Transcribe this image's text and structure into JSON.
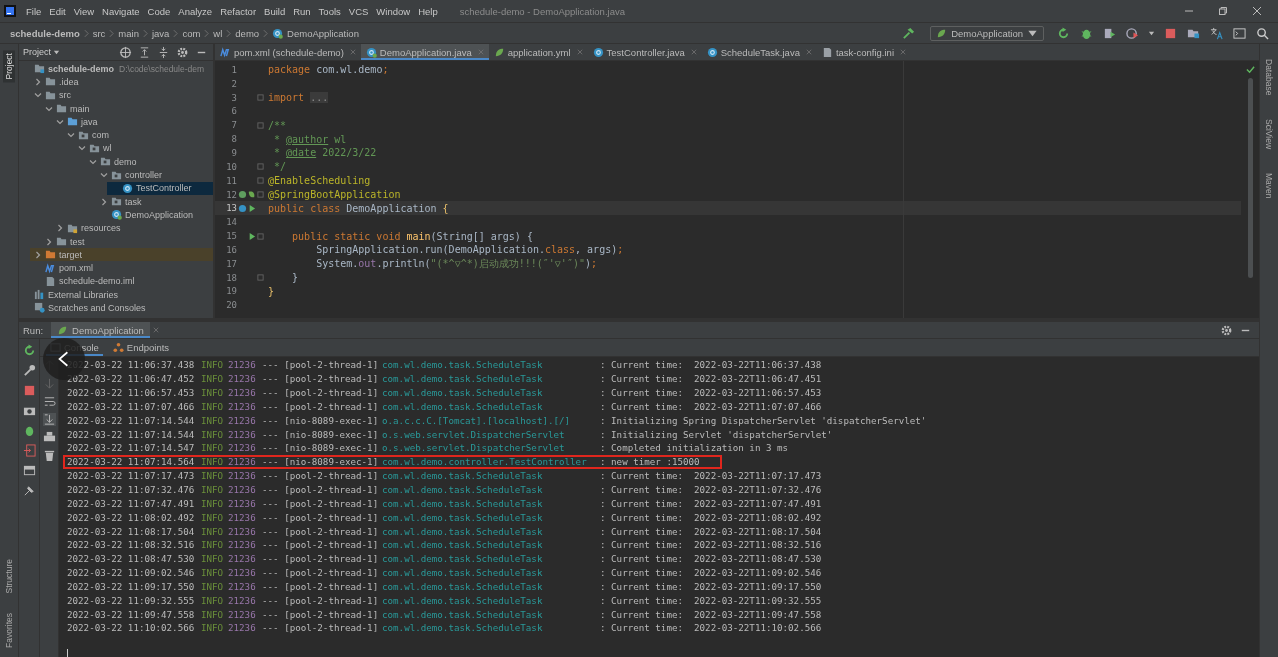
{
  "window": {
    "title": "schedule-demo - DemoApplication.java"
  },
  "menu": [
    "File",
    "Edit",
    "View",
    "Navigate",
    "Code",
    "Analyze",
    "Refactor",
    "Build",
    "Run",
    "Tools",
    "VCS",
    "Window",
    "Help"
  ],
  "breadcrumbs": [
    {
      "label": "schedule-demo",
      "kind": "project"
    },
    {
      "label": "src",
      "kind": "folder"
    },
    {
      "label": "main",
      "kind": "folder"
    },
    {
      "label": "java",
      "kind": "folder"
    },
    {
      "label": "com",
      "kind": "folder"
    },
    {
      "label": "wl",
      "kind": "folder"
    },
    {
      "label": "demo",
      "kind": "folder"
    },
    {
      "label": "DemoApplication",
      "kind": "class"
    }
  ],
  "run_config": "DemoApplication",
  "left_strip": {
    "top": [
      {
        "label": "Project",
        "selected": true
      }
    ],
    "bottom": [
      {
        "label": "Structure",
        "selected": false
      },
      {
        "label": "Favorites",
        "selected": false
      }
    ]
  },
  "right_strip": [
    {
      "label": "Database",
      "selected": false
    },
    {
      "label": "SciView",
      "selected": false
    },
    {
      "label": "Maven",
      "selected": false
    }
  ],
  "project_panel": {
    "title": "Project",
    "tree": [
      {
        "label": "schedule-demo",
        "path": "D:\\code\\schedule-dem",
        "kind": "module",
        "selected": false,
        "excluded": false,
        "children": [
          {
            "label": ".idea",
            "kind": "folder",
            "expanded": false,
            "selected": false,
            "excluded": false
          },
          {
            "label": "src",
            "kind": "folder",
            "expanded": true,
            "selected": false,
            "excluded": false,
            "children": [
              {
                "label": "main",
                "kind": "folder",
                "expanded": true,
                "selected": false,
                "excluded": false,
                "children": [
                  {
                    "label": "java",
                    "kind": "source",
                    "expanded": true,
                    "selected": false,
                    "excluded": false,
                    "children": [
                      {
                        "label": "com",
                        "kind": "package",
                        "expanded": true,
                        "selected": false,
                        "excluded": false,
                        "children": [
                          {
                            "label": "wl",
                            "kind": "package",
                            "expanded": true,
                            "selected": false,
                            "excluded": false,
                            "children": [
                              {
                                "label": "demo",
                                "kind": "package",
                                "expanded": true,
                                "selected": false,
                                "excluded": false,
                                "children": [
                                  {
                                    "label": "controller",
                                    "kind": "package",
                                    "expanded": true,
                                    "selected": false,
                                    "excluded": false,
                                    "children": [
                                      {
                                        "label": "TestController",
                                        "kind": "class",
                                        "selected": true,
                                        "excluded": false
                                      }
                                    ]
                                  },
                                  {
                                    "label": "task",
                                    "kind": "package",
                                    "expanded": false,
                                    "selected": false,
                                    "excluded": false
                                  },
                                  {
                                    "label": "DemoApplication",
                                    "kind": "app",
                                    "selected": false,
                                    "excluded": false
                                  }
                                ]
                              }
                            ]
                          }
                        ]
                      }
                    ]
                  },
                  {
                    "label": "resources",
                    "kind": "resources",
                    "expanded": false,
                    "selected": false,
                    "excluded": false
                  }
                ]
              },
              {
                "label": "test",
                "kind": "folder",
                "expanded": false,
                "selected": false,
                "excluded": false
              }
            ]
          },
          {
            "label": "target",
            "kind": "target",
            "expanded": false,
            "selected": false,
            "excluded": true
          },
          {
            "label": "pom.xml",
            "kind": "maven",
            "selected": false,
            "excluded": false
          },
          {
            "label": "schedule-demo.iml",
            "kind": "iml",
            "selected": false,
            "excluded": false
          }
        ]
      },
      {
        "label": "External Libraries",
        "kind": "libraries",
        "selected": false,
        "excluded": false
      },
      {
        "label": "Scratches and Consoles",
        "kind": "scratches",
        "selected": false,
        "excluded": false
      }
    ]
  },
  "editor_tabs": [
    {
      "label": "pom.xml (schedule-demo)",
      "kind": "maven",
      "selected": false
    },
    {
      "label": "DemoApplication.java",
      "kind": "app",
      "selected": true
    },
    {
      "label": "application.yml",
      "kind": "yml",
      "selected": false
    },
    {
      "label": "TestController.java",
      "kind": "class",
      "selected": false
    },
    {
      "label": "ScheduleTask.java",
      "kind": "class",
      "selected": false
    },
    {
      "label": "task-config.ini",
      "kind": "file",
      "selected": false
    }
  ],
  "code_lines": [
    {
      "number": "1",
      "fold": false,
      "current": false,
      "tokens": [
        {
          "t": "package ",
          "kind": "kw"
        },
        {
          "t": "com.wl.demo",
          "kind": "plain"
        },
        {
          "t": ";",
          "kind": "kw"
        }
      ]
    },
    {
      "number": "2",
      "fold": false,
      "current": false
    },
    {
      "number": "3",
      "fold": true,
      "current": false,
      "tokens": [
        {
          "t": "import ",
          "kind": "kw"
        },
        {
          "t": "...",
          "kind": "folded"
        }
      ]
    },
    {
      "number": "6",
      "fold": false,
      "current": false
    },
    {
      "number": "7",
      "fold": true,
      "current": false,
      "tokens": [
        {
          "t": "/**",
          "kind": "doc"
        }
      ]
    },
    {
      "number": "8",
      "fold": false,
      "current": false,
      "tokens": [
        {
          "t": " * ",
          "kind": "doc"
        },
        {
          "t": "@author",
          "kind": "doctag"
        },
        {
          "t": " wl",
          "kind": "doc"
        }
      ]
    },
    {
      "number": "9",
      "fold": false,
      "current": false,
      "tokens": [
        {
          "t": " * ",
          "kind": "doc"
        },
        {
          "t": "@date",
          "kind": "doctag"
        },
        {
          "t": " 2022/3/22",
          "kind": "doc"
        }
      ]
    },
    {
      "number": "10",
      "fold": true,
      "current": false,
      "tokens": [
        {
          "t": " */",
          "kind": "doc"
        }
      ]
    },
    {
      "number": "11",
      "fold": true,
      "current": false,
      "tokens": [
        {
          "t": "@EnableScheduling",
          "kind": "ann"
        }
      ]
    },
    {
      "number": "12",
      "fold": true,
      "current": false,
      "kind": "bean",
      "tokens": [
        {
          "t": "@SpringBootApplication",
          "kind": "ann"
        }
      ]
    },
    {
      "number": "13",
      "fold": false,
      "current": true,
      "kind": "bean-run",
      "tokens": [
        {
          "t": "public class ",
          "kind": "kw"
        },
        {
          "t": "DemoApplication ",
          "kind": "plain"
        },
        {
          "t": "{",
          "kind": "brace"
        }
      ]
    },
    {
      "number": "14",
      "fold": false,
      "current": false
    },
    {
      "number": "15",
      "fold": true,
      "current": false,
      "kind": "run",
      "tokens": [
        {
          "t": "    public static void ",
          "kind": "kw"
        },
        {
          "t": "main",
          "kind": "fn"
        },
        {
          "t": "(String[] args) {",
          "kind": "plain"
        }
      ]
    },
    {
      "number": "16",
      "fold": false,
      "current": false,
      "tokens": [
        {
          "t": "        SpringApplication.run(DemoApplication.",
          "kind": "plain"
        },
        {
          "t": "class",
          "kind": "kw"
        },
        {
          "t": ", args)",
          "kind": "plain"
        },
        {
          "t": ";",
          "kind": "kw"
        }
      ]
    },
    {
      "number": "17",
      "fold": false,
      "current": false,
      "tokens": [
        {
          "t": "        System.",
          "kind": "plain"
        },
        {
          "t": "out",
          "kind": "field"
        },
        {
          "t": ".println(",
          "kind": "plain"
        },
        {
          "t": "\"(*^▽^*)启动成功!!!(″'▽'″)\"",
          "kind": "str"
        },
        {
          "t": ")",
          "kind": "plain"
        },
        {
          "t": ";",
          "kind": "kw"
        }
      ]
    },
    {
      "number": "18",
      "fold": true,
      "current": false,
      "tokens": [
        {
          "t": "    }",
          "kind": "plain"
        }
      ]
    },
    {
      "number": "19",
      "fold": false,
      "current": false,
      "tokens": [
        {
          "t": "}",
          "kind": "brace"
        }
      ]
    },
    {
      "number": "20",
      "fold": false,
      "current": false
    }
  ],
  "run_panel": {
    "label": "Run:",
    "tab": "DemoApplication",
    "subtabs": [
      {
        "label": "Console",
        "kind": "console",
        "selected": true
      },
      {
        "label": "Endpoints",
        "kind": "endpoints",
        "selected": false
      }
    ],
    "log": [
      {
        "time": "2022-03-22 11:06:37.438",
        "level": "INFO",
        "pid": "21236",
        "thread": "--- [pool-2-thread-1]",
        "logger": "com.wl.demo.task.ScheduleTask",
        "message": ": Current time:  2022-03-22T11:06:37.438",
        "highlighted": false
      },
      {
        "time": "2022-03-22 11:06:47.452",
        "level": "INFO",
        "pid": "21236",
        "thread": "--- [pool-2-thread-1]",
        "logger": "com.wl.demo.task.ScheduleTask",
        "message": ": Current time:  2022-03-22T11:06:47.451",
        "highlighted": false
      },
      {
        "time": "2022-03-22 11:06:57.453",
        "level": "INFO",
        "pid": "21236",
        "thread": "--- [pool-2-thread-1]",
        "logger": "com.wl.demo.task.ScheduleTask",
        "message": ": Current time:  2022-03-22T11:06:57.453",
        "highlighted": false
      },
      {
        "time": "2022-03-22 11:07:07.466",
        "level": "INFO",
        "pid": "21236",
        "thread": "--- [pool-2-thread-1]",
        "logger": "com.wl.demo.task.ScheduleTask",
        "message": ": Current time:  2022-03-22T11:07:07.466",
        "highlighted": false
      },
      {
        "time": "2022-03-22 11:07:14.544",
        "level": "INFO",
        "pid": "21236",
        "thread": "--- [nio-8089-exec-1]",
        "logger": "o.a.c.c.C.[Tomcat].[localhost].[/]",
        "message": ": Initializing Spring DispatcherServlet 'dispatcherServlet'",
        "highlighted": false
      },
      {
        "time": "2022-03-22 11:07:14.544",
        "level": "INFO",
        "pid": "21236",
        "thread": "--- [nio-8089-exec-1]",
        "logger": "o.s.web.servlet.DispatcherServlet",
        "message": ": Initializing Servlet 'dispatcherServlet'",
        "highlighted": false
      },
      {
        "time": "2022-03-22 11:07:14.547",
        "level": "INFO",
        "pid": "21236",
        "thread": "--- [nio-8089-exec-1]",
        "logger": "o.s.web.servlet.DispatcherServlet",
        "message": ": Completed initialization in 3 ms",
        "highlighted": false
      },
      {
        "time": "2022-03-22 11:07:14.564",
        "level": "INFO",
        "pid": "21236",
        "thread": "--- [nio-8089-exec-1]",
        "logger": "com.wl.demo.controller.TestController",
        "message": ": new timer :15000",
        "highlighted": true
      },
      {
        "time": "2022-03-22 11:07:17.473",
        "level": "INFO",
        "pid": "21236",
        "thread": "--- [pool-2-thread-1]",
        "logger": "com.wl.demo.task.ScheduleTask",
        "message": ": Current time:  2022-03-22T11:07:17.473",
        "highlighted": false
      },
      {
        "time": "2022-03-22 11:07:32.476",
        "level": "INFO",
        "pid": "21236",
        "thread": "--- [pool-2-thread-1]",
        "logger": "com.wl.demo.task.ScheduleTask",
        "message": ": Current time:  2022-03-22T11:07:32.476",
        "highlighted": false
      },
      {
        "time": "2022-03-22 11:07:47.491",
        "level": "INFO",
        "pid": "21236",
        "thread": "--- [pool-2-thread-1]",
        "logger": "com.wl.demo.task.ScheduleTask",
        "message": ": Current time:  2022-03-22T11:07:47.491",
        "highlighted": false
      },
      {
        "time": "2022-03-22 11:08:02.492",
        "level": "INFO",
        "pid": "21236",
        "thread": "--- [pool-2-thread-1]",
        "logger": "com.wl.demo.task.ScheduleTask",
        "message": ": Current time:  2022-03-22T11:08:02.492",
        "highlighted": false
      },
      {
        "time": "2022-03-22 11:08:17.504",
        "level": "INFO",
        "pid": "21236",
        "thread": "--- [pool-2-thread-1]",
        "logger": "com.wl.demo.task.ScheduleTask",
        "message": ": Current time:  2022-03-22T11:08:17.504",
        "highlighted": false
      },
      {
        "time": "2022-03-22 11:08:32.516",
        "level": "INFO",
        "pid": "21236",
        "thread": "--- [pool-2-thread-1]",
        "logger": "com.wl.demo.task.ScheduleTask",
        "message": ": Current time:  2022-03-22T11:08:32.516",
        "highlighted": false
      },
      {
        "time": "2022-03-22 11:08:47.530",
        "level": "INFO",
        "pid": "21236",
        "thread": "--- [pool-2-thread-1]",
        "logger": "com.wl.demo.task.ScheduleTask",
        "message": ": Current time:  2022-03-22T11:08:47.530",
        "highlighted": false
      },
      {
        "time": "2022-03-22 11:09:02.546",
        "level": "INFO",
        "pid": "21236",
        "thread": "--- [pool-2-thread-1]",
        "logger": "com.wl.demo.task.ScheduleTask",
        "message": ": Current time:  2022-03-22T11:09:02.546",
        "highlighted": false
      },
      {
        "time": "2022-03-22 11:09:17.550",
        "level": "INFO",
        "pid": "21236",
        "thread": "--- [pool-2-thread-1]",
        "logger": "com.wl.demo.task.ScheduleTask",
        "message": ": Current time:  2022-03-22T11:09:17.550",
        "highlighted": false
      },
      {
        "time": "2022-03-22 11:09:32.555",
        "level": "INFO",
        "pid": "21236",
        "thread": "--- [pool-2-thread-1]",
        "logger": "com.wl.demo.task.ScheduleTask",
        "message": ": Current time:  2022-03-22T11:09:32.555",
        "highlighted": false
      },
      {
        "time": "2022-03-22 11:09:47.558",
        "level": "INFO",
        "pid": "21236",
        "thread": "--- [pool-2-thread-1]",
        "logger": "com.wl.demo.task.ScheduleTask",
        "message": ": Current time:  2022-03-22T11:09:47.558",
        "highlighted": false
      },
      {
        "time": "2022-03-22 11:10:02.566",
        "level": "INFO",
        "pid": "21236",
        "thread": "--- [pool-2-thread-1]",
        "logger": "com.wl.demo.task.ScheduleTask",
        "message": ": Current time:  2022-03-22T11:10:02.566",
        "highlighted": false
      }
    ]
  }
}
